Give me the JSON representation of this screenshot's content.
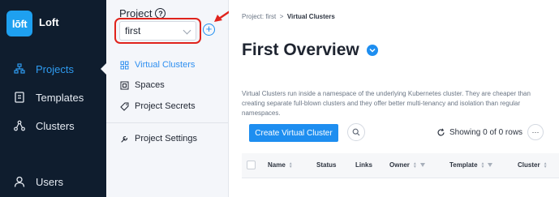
{
  "nav": {
    "logo_text": "lōft",
    "app_name": "Loft",
    "items": [
      {
        "label": "Projects",
        "icon": "projects-icon"
      },
      {
        "label": "Templates",
        "icon": "templates-icon"
      },
      {
        "label": "Clusters",
        "icon": "clusters-icon"
      },
      {
        "label": "Users",
        "icon": "user-icon"
      }
    ],
    "active": "Projects",
    "active_color": "#2e9bf0",
    "bg": "#0f1d2e"
  },
  "project_panel": {
    "label": "Project",
    "help": "?",
    "selected_project": "first",
    "add_label": "+",
    "items": [
      {
        "label": "Virtual Clusters",
        "icon": "virtual-clusters-icon"
      },
      {
        "label": "Spaces",
        "icon": "spaces-icon"
      },
      {
        "label": "Project Secrets",
        "icon": "secrets-icon"
      },
      {
        "label": "Project Settings",
        "icon": "settings-icon"
      }
    ],
    "highlight_color": "#e0231c"
  },
  "main": {
    "breadcrumb": {
      "root": "Project: first",
      "separator": ">",
      "current": "Virtual Clusters"
    },
    "title": "First Overview",
    "description": "Virtual Clusters run inside a namespace of the underlying Kubernetes cluster. They are cheaper than creating separate full-blown clusters and they offer better multi-tenancy and isolation than regular namespaces.",
    "create_button": "Create Virtual Cluster",
    "showing": "Showing 0 of 0 rows",
    "more": "···",
    "columns": [
      "Name",
      "Status",
      "Links",
      "Owner",
      "Template",
      "Cluster"
    ],
    "accent": "#1e8ef0"
  }
}
